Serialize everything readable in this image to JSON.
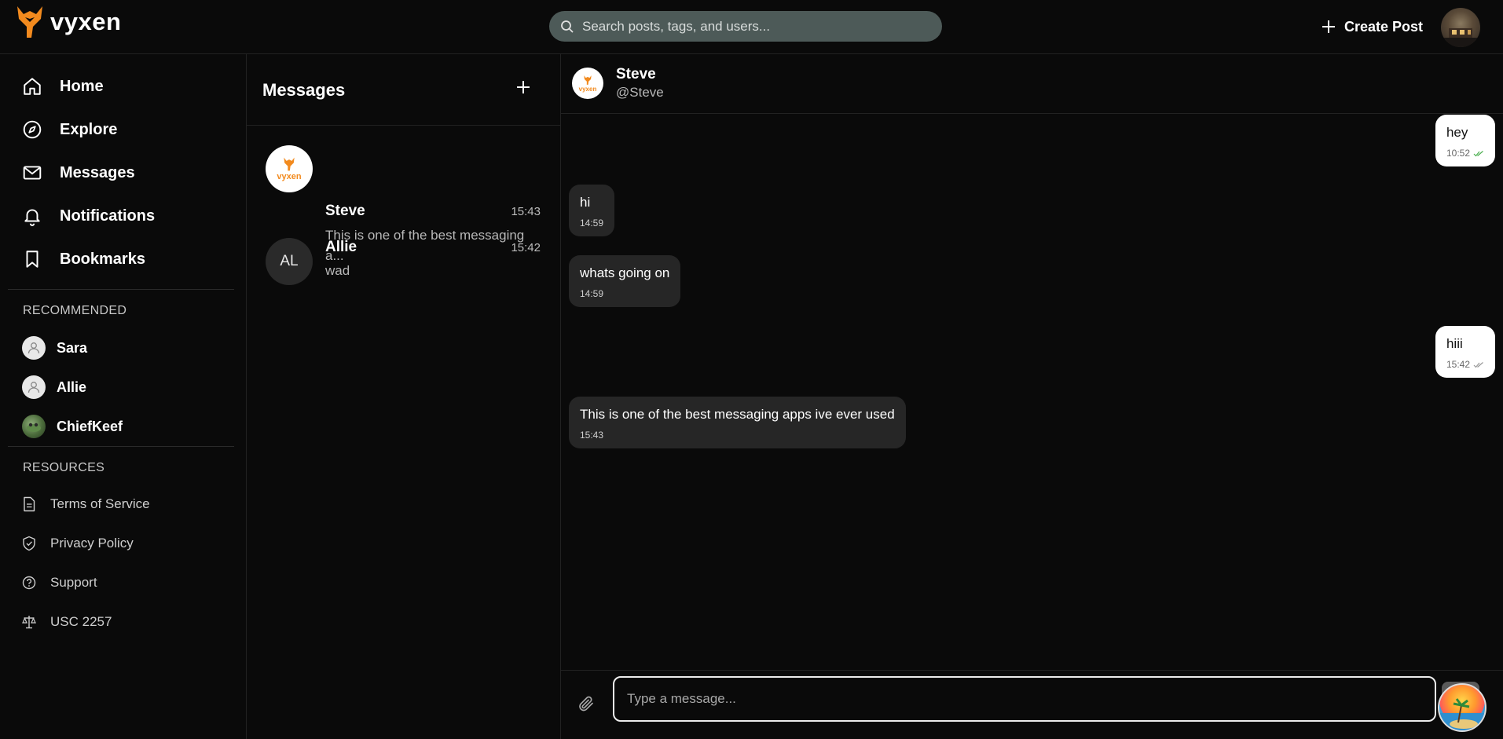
{
  "app": {
    "logo_text": "vyxen"
  },
  "header": {
    "search_placeholder": "Search posts, tags, and users...",
    "create_post_label": "Create Post"
  },
  "sidebar": {
    "nav": [
      {
        "label": "Home",
        "icon": "home-icon"
      },
      {
        "label": "Explore",
        "icon": "compass-icon"
      },
      {
        "label": "Messages",
        "icon": "mail-icon"
      },
      {
        "label": "Notifications",
        "icon": "bell-icon"
      },
      {
        "label": "Bookmarks",
        "icon": "bookmark-icon"
      }
    ],
    "recommended_title": "RECOMMENDED",
    "recommended": [
      {
        "name": "Sara",
        "avatar": "user-placeholder"
      },
      {
        "name": "Allie",
        "avatar": "user-placeholder"
      },
      {
        "name": "ChiefKeef",
        "avatar": "photo"
      }
    ],
    "resources_title": "RESOURCES",
    "resources": [
      {
        "label": "Terms of Service",
        "icon": "document-icon"
      },
      {
        "label": "Privacy Policy",
        "icon": "shield-icon"
      },
      {
        "label": "Support",
        "icon": "help-circle-icon"
      },
      {
        "label": "USC 2257",
        "icon": "scale-icon"
      }
    ]
  },
  "messages": {
    "title": "Messages",
    "conversations": [
      {
        "name": "Steve",
        "time": "15:43",
        "preview": "This is one of the best messaging a...",
        "avatar_text": "vyxen"
      },
      {
        "name": "Allie",
        "time": "15:42",
        "preview": "wad",
        "avatar_text": "AL"
      }
    ]
  },
  "chat": {
    "name": "Steve",
    "handle": "@Steve",
    "avatar_text": "vyxen",
    "messages": [
      {
        "direction": "out",
        "text": "hey",
        "time": "10:52",
        "read": true
      },
      {
        "direction": "in",
        "text": "hi",
        "time": "14:59"
      },
      {
        "direction": "in",
        "text": "whats going on",
        "time": "14:59"
      },
      {
        "direction": "out",
        "text": "hiii",
        "time": "15:42",
        "read": false
      },
      {
        "direction": "in",
        "text": "This is one of the best messaging apps ive ever used",
        "time": "15:43"
      }
    ],
    "input_placeholder": "Type a message..."
  },
  "colors": {
    "background": "#0a0a0a",
    "brand_orange": "#f28a1e",
    "search_bg": "#4d5a58",
    "incoming_bubble": "#262626",
    "outgoing_bubble": "#ffffff",
    "read_check": "#4caf50"
  }
}
